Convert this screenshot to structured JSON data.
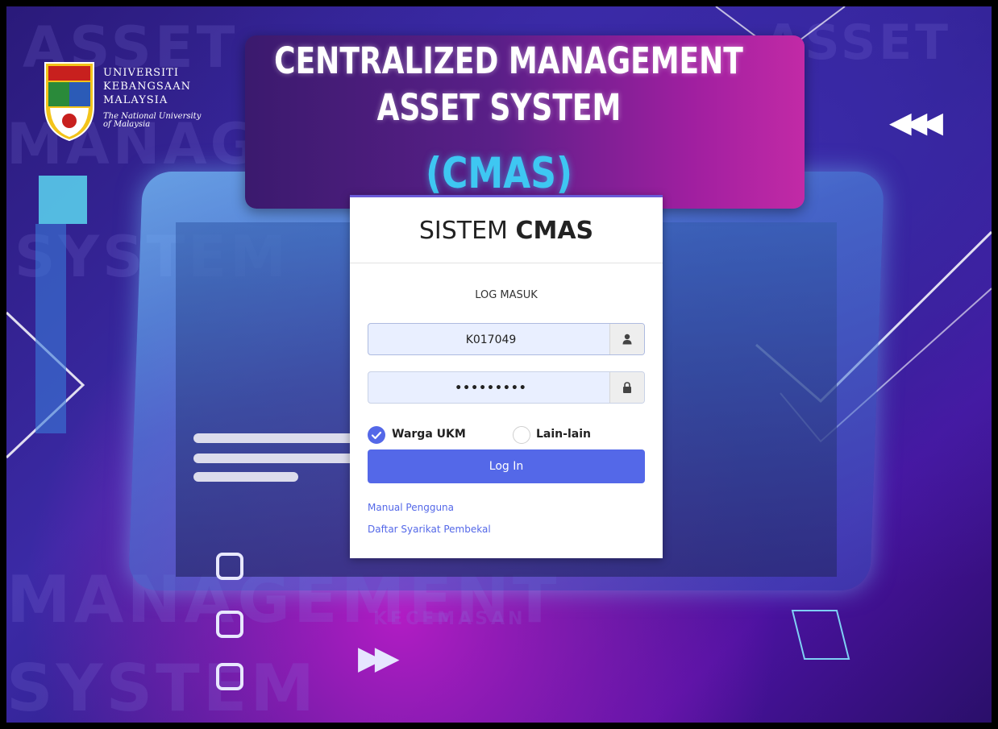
{
  "banner": {
    "line1": "CENTRALIZED MANAGEMENT",
    "line2": "ASSET SYSTEM",
    "line3": "(CMAS)"
  },
  "logo": {
    "line1": "UNIVERSITI",
    "line2": "KEBANGSAAN",
    "line3": "MALAYSIA",
    "tagline1": "The National University",
    "tagline2": "of Malaysia"
  },
  "background_words": [
    "ASSET",
    "MANAGEMENT",
    "SYSTEM",
    "ASSET",
    "MANAGEMENT",
    "SYSTEM",
    "KECEMASAN"
  ],
  "card": {
    "title_light": "SISTEM ",
    "title_bold": "CMAS",
    "subtitle": "LOG MASUK",
    "username_value": "K017049",
    "password_value": "•••••••••",
    "radio_options": [
      {
        "label": "Warga UKM",
        "selected": true
      },
      {
        "label": "Lain-lain",
        "selected": false
      }
    ],
    "login_label": "Log In",
    "links": [
      "Manual Pengguna",
      "Daftar Syarikat Pembekal"
    ]
  },
  "colors": {
    "accent": "#5468e8",
    "banner_cyan": "#3ec7f2",
    "banner_magenta": "#c22aa6"
  },
  "icons": [
    "user-icon",
    "lock-icon",
    "check-icon"
  ]
}
